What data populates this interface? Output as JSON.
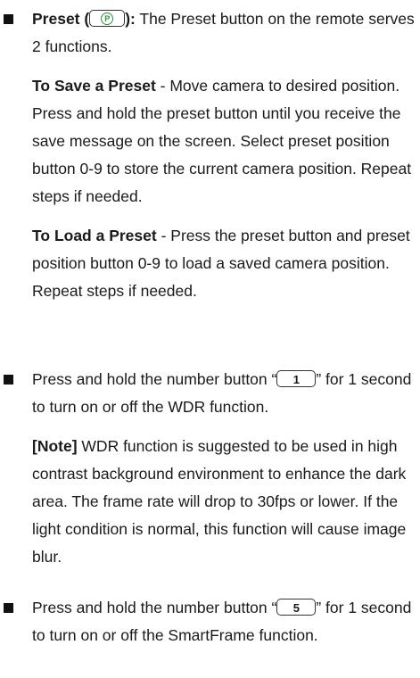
{
  "preset": {
    "title": "Preset (",
    "title_close": "):",
    "intro": " The Preset button on the remote serves 2 functions.",
    "icon_glyph": "P",
    "save_heading": "To Save a Preset",
    "save_text": " - Move camera to desired position. Press and hold the preset button until you receive the save message on the screen. Select preset position button 0-9 to store the current camera position. Repeat steps if needed.",
    "load_heading": "To Load a Preset",
    "load_text": " - Press the preset button and preset position button 0-9 to load a saved camera position. Repeat steps if needed."
  },
  "wdr": {
    "text_before": "Press and hold the number button “",
    "key": "1",
    "text_after": "” for 1 second to turn on or off the WDR function.",
    "note_heading": "[Note]",
    "note_text": " WDR function is suggested to be used in high contrast background environment to enhance the dark area. The frame rate will drop to 30fps or lower. If the light condition is normal, this function will cause image blur."
  },
  "smartframe": {
    "text_before": "Press and hold the number button “",
    "key": "5",
    "text_after": "” for 1 second to turn on or off the SmartFrame function."
  }
}
